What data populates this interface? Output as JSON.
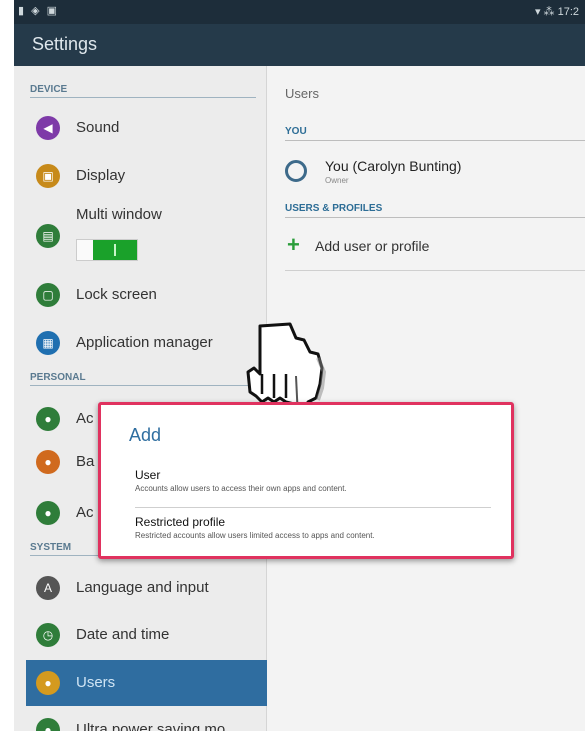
{
  "statusbar": {
    "left_icons": "▮ ◈ ▣",
    "right_text": "▾ ⁂ 17:2"
  },
  "header": {
    "title": "Settings"
  },
  "sidebar": {
    "sections": {
      "device": "DEVICE",
      "personal": "PERSONAL",
      "system": "SYSTEM"
    },
    "items": [
      {
        "label": "Sound",
        "icon": "sound-icon",
        "color": "#7e3aa8",
        "glyph": "◀"
      },
      {
        "label": "Display",
        "icon": "display-icon",
        "color": "#c78a1a",
        "glyph": "▣"
      },
      {
        "label": "Multi window",
        "icon": "multi-window-icon",
        "color": "#2f7d3a",
        "glyph": "▤"
      },
      {
        "label": "Lock screen",
        "icon": "lock-screen-icon",
        "color": "#2f7d3a",
        "glyph": "▢"
      },
      {
        "label": "Application manager",
        "icon": "app-manager-icon",
        "color": "#1f6fb0",
        "glyph": "▦"
      },
      {
        "label": "Ac",
        "icon": "accounts-icon",
        "color": "#2f7d3a",
        "glyph": "●"
      },
      {
        "label": "Ba",
        "icon": "backup-icon",
        "color": "#d06a1e",
        "glyph": "●"
      },
      {
        "label": "Ac",
        "icon": "accessibility-icon",
        "color": "#2f7d3a",
        "glyph": "●"
      },
      {
        "label": "Language and input",
        "icon": "language-icon",
        "color": "#555555",
        "glyph": "A"
      },
      {
        "label": "Date and time",
        "icon": "date-time-icon",
        "color": "#2f7d3a",
        "glyph": "◷"
      },
      {
        "label": "Users",
        "icon": "users-icon",
        "color": "#d49a1f",
        "glyph": "●"
      },
      {
        "label": "Ultra power saving mo",
        "icon": "power-saving-icon",
        "color": "#2f7d3a",
        "glyph": "●"
      }
    ]
  },
  "main": {
    "title": "Users",
    "you_section": "YOU",
    "user_name": "You (Carolyn Bunting)",
    "user_role": "Owner",
    "profiles_section": "USERS & PROFILES",
    "add_label": "Add user or profile"
  },
  "dialog": {
    "title": "Add",
    "options": [
      {
        "title": "User",
        "desc": "Accounts allow users to access their own apps and content."
      },
      {
        "title": "Restricted profile",
        "desc": "Restricted accounts allow users limited access to apps and content."
      }
    ]
  },
  "colors": {
    "accent": "#2f6da0",
    "dialog_border": "#e0325f",
    "toggle_on": "#1aa12a"
  }
}
